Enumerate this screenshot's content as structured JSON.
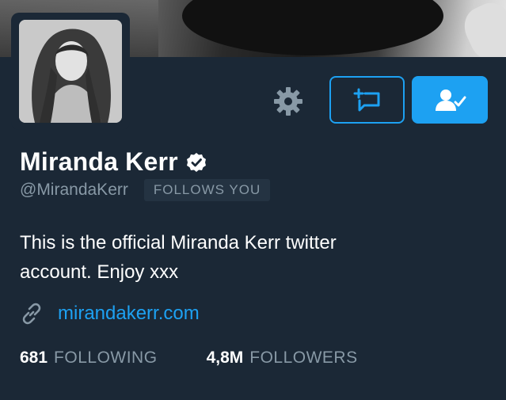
{
  "profile": {
    "name": "Miranda Kerr",
    "handle": "@MirandaKerr",
    "follows_you": "FOLLOWS YOU",
    "bio_line1": "This is the official Miranda Kerr twitter",
    "bio_line2": "account. Enjoy xxx",
    "website": "mirandakerr.com",
    "verified": true
  },
  "stats": {
    "following_count": "681",
    "following_label": "FOLLOWING",
    "followers_count": "4,8M",
    "followers_label": "FOLLOWERS"
  },
  "icons": {
    "settings": "gear-icon",
    "message": "direct-message-icon",
    "following": "user-check-icon",
    "verified": "verified-badge-icon",
    "link": "link-icon"
  },
  "colors": {
    "background": "#1b2836",
    "accent": "#1da1f2",
    "muted_text": "#8899a6",
    "badge_bg": "#243342"
  }
}
